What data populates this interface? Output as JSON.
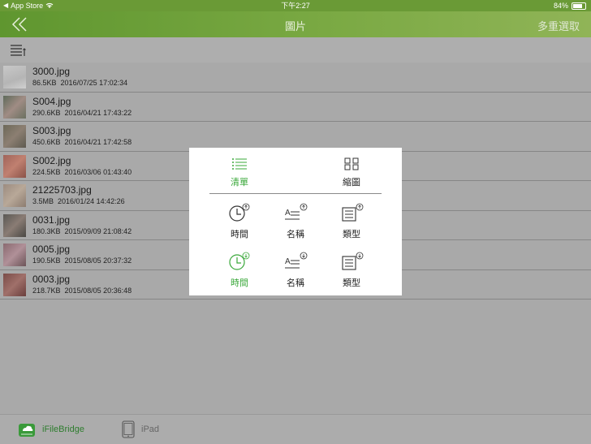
{
  "status_bar": {
    "carrier": "App Store",
    "time": "下午2:27",
    "battery": "84%"
  },
  "nav": {
    "title": "圖片",
    "right_action": "多重選取"
  },
  "files": [
    {
      "name": "3000.jpg",
      "size": "86.5KB",
      "date": "2016/07/25 17:02:34"
    },
    {
      "name": "S004.jpg",
      "size": "290.6KB",
      "date": "2016/04/21 17:43:22"
    },
    {
      "name": "S003.jpg",
      "size": "450.6KB",
      "date": "2016/04/21 17:42:58"
    },
    {
      "name": "S002.jpg",
      "size": "224.5KB",
      "date": "2016/03/06 01:43:40"
    },
    {
      "name": "21225703.jpg",
      "size": "3.5MB",
      "date": "2016/01/24 14:42:26"
    },
    {
      "name": "0031.jpg",
      "size": "180.3KB",
      "date": "2015/09/09 21:08:42"
    },
    {
      "name": "0005.jpg",
      "size": "190.5KB",
      "date": "2015/08/05 20:37:32"
    },
    {
      "name": "0003.jpg",
      "size": "218.7KB",
      "date": "2015/08/05 20:36:48"
    }
  ],
  "view_menu": {
    "list_label": "清單",
    "grid_label": "縮圖"
  },
  "sort_menu": {
    "ascending": {
      "time": "時間",
      "name": "名稱",
      "type": "類型"
    },
    "descending": {
      "time": "時間",
      "name": "名稱",
      "type": "類型"
    }
  },
  "tabs": [
    {
      "label": "iFileBridge"
    },
    {
      "label": "iPad"
    }
  ],
  "colors": {
    "accent": "#3aa83a",
    "nav_green": "#6a9a36",
    "overlay_gray": "#a9a9a9"
  }
}
